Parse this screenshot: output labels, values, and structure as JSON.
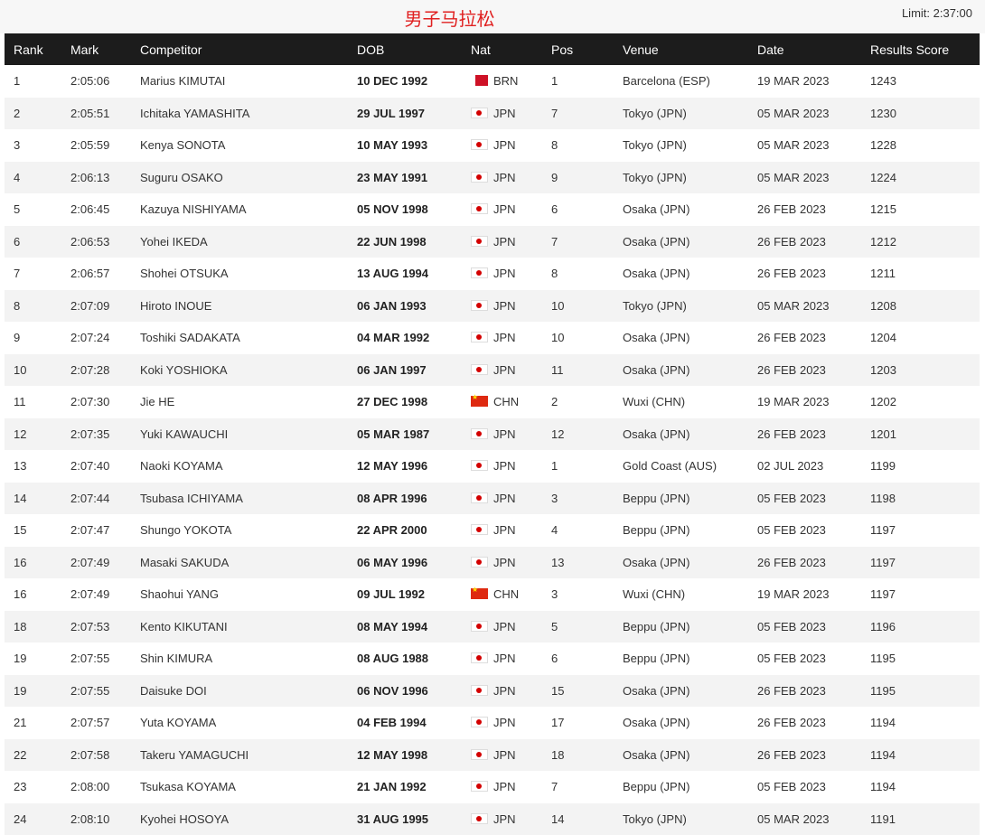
{
  "page": {
    "title": "男子马拉松",
    "limit": "Limit: 2:37:00"
  },
  "columns": [
    "Rank",
    "Mark",
    "Competitor",
    "DOB",
    "Nat",
    "Pos",
    "Venue",
    "Date",
    "Results Score"
  ],
  "rows": [
    {
      "rank": "1",
      "mark": "2:05:06",
      "competitor": "Marius KIMUTAI",
      "dob": "10 DEC 1992",
      "nat": "BRN",
      "flag": "bahrain-flag-icon",
      "pos": "1",
      "venue": "Barcelona (ESP)",
      "date": "19 MAR 2023",
      "score": "1243"
    },
    {
      "rank": "2",
      "mark": "2:05:51",
      "competitor": "Ichitaka YAMASHITA",
      "dob": "29 JUL 1997",
      "nat": "JPN",
      "flag": "japan-flag-icon",
      "pos": "7",
      "venue": "Tokyo (JPN)",
      "date": "05 MAR 2023",
      "score": "1230"
    },
    {
      "rank": "3",
      "mark": "2:05:59",
      "competitor": "Kenya SONOTA",
      "dob": "10 MAY 1993",
      "nat": "JPN",
      "flag": "japan-flag-icon",
      "pos": "8",
      "venue": "Tokyo (JPN)",
      "date": "05 MAR 2023",
      "score": "1228"
    },
    {
      "rank": "4",
      "mark": "2:06:13",
      "competitor": "Suguru OSAKO",
      "dob": "23 MAY 1991",
      "nat": "JPN",
      "flag": "japan-flag-icon",
      "pos": "9",
      "venue": "Tokyo (JPN)",
      "date": "05 MAR 2023",
      "score": "1224"
    },
    {
      "rank": "5",
      "mark": "2:06:45",
      "competitor": "Kazuya NISHIYAMA",
      "dob": "05 NOV 1998",
      "nat": "JPN",
      "flag": "japan-flag-icon",
      "pos": "6",
      "venue": "Osaka (JPN)",
      "date": "26 FEB 2023",
      "score": "1215"
    },
    {
      "rank": "6",
      "mark": "2:06:53",
      "competitor": "Yohei IKEDA",
      "dob": "22 JUN 1998",
      "nat": "JPN",
      "flag": "japan-flag-icon",
      "pos": "7",
      "venue": "Osaka (JPN)",
      "date": "26 FEB 2023",
      "score": "1212"
    },
    {
      "rank": "7",
      "mark": "2:06:57",
      "competitor": "Shohei OTSUKA",
      "dob": "13 AUG 1994",
      "nat": "JPN",
      "flag": "japan-flag-icon",
      "pos": "8",
      "venue": "Osaka (JPN)",
      "date": "26 FEB 2023",
      "score": "1211"
    },
    {
      "rank": "8",
      "mark": "2:07:09",
      "competitor": "Hiroto INOUE",
      "dob": "06 JAN 1993",
      "nat": "JPN",
      "flag": "japan-flag-icon",
      "pos": "10",
      "venue": "Tokyo (JPN)",
      "date": "05 MAR 2023",
      "score": "1208"
    },
    {
      "rank": "9",
      "mark": "2:07:24",
      "competitor": "Toshiki SADAKATA",
      "dob": "04 MAR 1992",
      "nat": "JPN",
      "flag": "japan-flag-icon",
      "pos": "10",
      "venue": "Osaka (JPN)",
      "date": "26 FEB 2023",
      "score": "1204"
    },
    {
      "rank": "10",
      "mark": "2:07:28",
      "competitor": "Koki YOSHIOKA",
      "dob": "06 JAN 1997",
      "nat": "JPN",
      "flag": "japan-flag-icon",
      "pos": "11",
      "venue": "Osaka (JPN)",
      "date": "26 FEB 2023",
      "score": "1203"
    },
    {
      "rank": "11",
      "mark": "2:07:30",
      "competitor": "Jie HE",
      "dob": "27 DEC 1998",
      "nat": "CHN",
      "flag": "china-flag-icon",
      "pos": "2",
      "venue": "Wuxi (CHN)",
      "date": "19 MAR 2023",
      "score": "1202"
    },
    {
      "rank": "12",
      "mark": "2:07:35",
      "competitor": "Yuki KAWAUCHI",
      "dob": "05 MAR 1987",
      "nat": "JPN",
      "flag": "japan-flag-icon",
      "pos": "12",
      "venue": "Osaka (JPN)",
      "date": "26 FEB 2023",
      "score": "1201"
    },
    {
      "rank": "13",
      "mark": "2:07:40",
      "competitor": "Naoki KOYAMA",
      "dob": "12 MAY 1996",
      "nat": "JPN",
      "flag": "japan-flag-icon",
      "pos": "1",
      "venue": "Gold Coast (AUS)",
      "date": "02 JUL 2023",
      "score": "1199"
    },
    {
      "rank": "14",
      "mark": "2:07:44",
      "competitor": "Tsubasa ICHIYAMA",
      "dob": "08 APR 1996",
      "nat": "JPN",
      "flag": "japan-flag-icon",
      "pos": "3",
      "venue": "Beppu (JPN)",
      "date": "05 FEB 2023",
      "score": "1198"
    },
    {
      "rank": "15",
      "mark": "2:07:47",
      "competitor": "Shungo YOKOTA",
      "dob": "22 APR 2000",
      "nat": "JPN",
      "flag": "japan-flag-icon",
      "pos": "4",
      "venue": "Beppu (JPN)",
      "date": "05 FEB 2023",
      "score": "1197"
    },
    {
      "rank": "16",
      "mark": "2:07:49",
      "competitor": "Masaki SAKUDA",
      "dob": "06 MAY 1996",
      "nat": "JPN",
      "flag": "japan-flag-icon",
      "pos": "13",
      "venue": "Osaka (JPN)",
      "date": "26 FEB 2023",
      "score": "1197"
    },
    {
      "rank": "16",
      "mark": "2:07:49",
      "competitor": "Shaohui YANG",
      "dob": "09 JUL 1992",
      "nat": "CHN",
      "flag": "china-flag-icon",
      "pos": "3",
      "venue": "Wuxi (CHN)",
      "date": "19 MAR 2023",
      "score": "1197"
    },
    {
      "rank": "18",
      "mark": "2:07:53",
      "competitor": "Kento KIKUTANI",
      "dob": "08 MAY 1994",
      "nat": "JPN",
      "flag": "japan-flag-icon",
      "pos": "5",
      "venue": "Beppu (JPN)",
      "date": "05 FEB 2023",
      "score": "1196"
    },
    {
      "rank": "19",
      "mark": "2:07:55",
      "competitor": "Shin KIMURA",
      "dob": "08 AUG 1988",
      "nat": "JPN",
      "flag": "japan-flag-icon",
      "pos": "6",
      "venue": "Beppu (JPN)",
      "date": "05 FEB 2023",
      "score": "1195"
    },
    {
      "rank": "19",
      "mark": "2:07:55",
      "competitor": "Daisuke DOI",
      "dob": "06 NOV 1996",
      "nat": "JPN",
      "flag": "japan-flag-icon",
      "pos": "15",
      "venue": "Osaka (JPN)",
      "date": "26 FEB 2023",
      "score": "1195"
    },
    {
      "rank": "21",
      "mark": "2:07:57",
      "competitor": "Yuta KOYAMA",
      "dob": "04 FEB 1994",
      "nat": "JPN",
      "flag": "japan-flag-icon",
      "pos": "17",
      "venue": "Osaka (JPN)",
      "date": "26 FEB 2023",
      "score": "1194"
    },
    {
      "rank": "22",
      "mark": "2:07:58",
      "competitor": "Takeru YAMAGUCHI",
      "dob": "12 MAY 1998",
      "nat": "JPN",
      "flag": "japan-flag-icon",
      "pos": "18",
      "venue": "Osaka (JPN)",
      "date": "26 FEB 2023",
      "score": "1194"
    },
    {
      "rank": "23",
      "mark": "2:08:00",
      "competitor": "Tsukasa KOYAMA",
      "dob": "21 JAN 1992",
      "nat": "JPN",
      "flag": "japan-flag-icon",
      "pos": "7",
      "venue": "Beppu (JPN)",
      "date": "05 FEB 2023",
      "score": "1194"
    },
    {
      "rank": "24",
      "mark": "2:08:10",
      "competitor": "Kyohei HOSOYA",
      "dob": "31 AUG 1995",
      "nat": "JPN",
      "flag": "japan-flag-icon",
      "pos": "14",
      "venue": "Tokyo (JPN)",
      "date": "05 MAR 2023",
      "score": "1191"
    }
  ]
}
